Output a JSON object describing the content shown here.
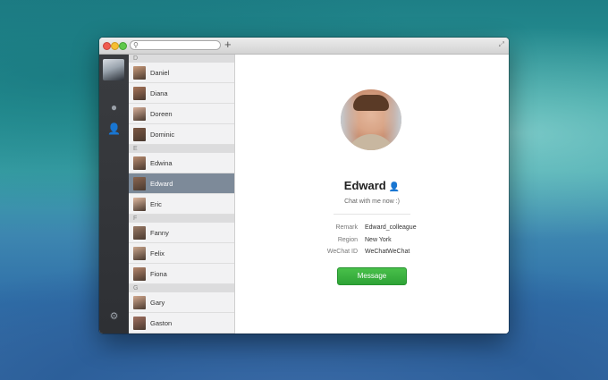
{
  "search": {
    "placeholder": ""
  },
  "toolbar": {
    "add_label": "+"
  },
  "sections": [
    {
      "letter": "D",
      "contacts": [
        "Daniel",
        "Diana",
        "Doreen",
        "Dominic"
      ]
    },
    {
      "letter": "E",
      "contacts": [
        "Edwina",
        "Edward",
        "Eric"
      ]
    },
    {
      "letter": "F",
      "contacts": [
        "Fanny",
        "Felix",
        "Fiona"
      ]
    },
    {
      "letter": "G",
      "contacts": [
        "Gary",
        "Gaston"
      ]
    }
  ],
  "selected_contact": "Edward",
  "profile": {
    "name": "Edward",
    "signature": "Chat with me now :)",
    "fields": [
      {
        "label": "Remark",
        "value": "Edward_colleague"
      },
      {
        "label": "Region",
        "value": "New York"
      },
      {
        "label": "WeChat ID",
        "value": "WeChatWeChat"
      }
    ],
    "message_button": "Message"
  },
  "colors": {
    "accent_green": "#3ab43f",
    "selected_row": "#7d8a99",
    "sidebar_dark": "#34363a"
  }
}
